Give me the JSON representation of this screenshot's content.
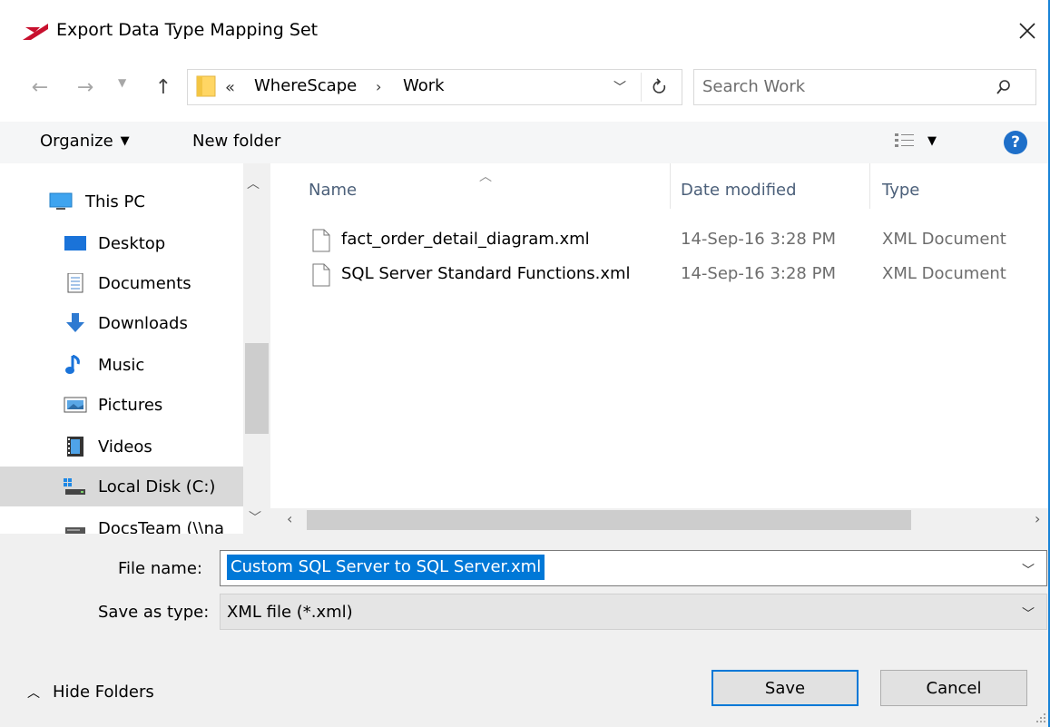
{
  "window": {
    "title": "Export Data Type Mapping Set",
    "close_icon": "close-icon",
    "accent_color": "#0078d7"
  },
  "address": {
    "chevron": "«",
    "breadcrumbs": [
      "WhereScape",
      "Work"
    ],
    "separator": "›"
  },
  "search": {
    "placeholder": "Search Work"
  },
  "toolbar": {
    "organize_label": "Organize",
    "new_folder_label": "New folder",
    "help_label": "?"
  },
  "nav": {
    "items": [
      {
        "label": "This PC",
        "icon": "this-pc-icon"
      },
      {
        "label": "Desktop",
        "icon": "desktop-icon"
      },
      {
        "label": "Documents",
        "icon": "documents-icon"
      },
      {
        "label": "Downloads",
        "icon": "downloads-icon"
      },
      {
        "label": "Music",
        "icon": "music-icon"
      },
      {
        "label": "Pictures",
        "icon": "pictures-icon"
      },
      {
        "label": "Videos",
        "icon": "videos-icon"
      },
      {
        "label": "Local Disk (C:)",
        "icon": "local-disk-icon"
      },
      {
        "label": "DocsTeam (\\\\na",
        "icon": "network-drive-icon"
      }
    ],
    "selected_index": 7
  },
  "files": {
    "columns": [
      "Name",
      "Date modified",
      "Type"
    ],
    "rows": [
      {
        "name": "fact_order_detail_diagram.xml",
        "date": "14-Sep-16 3:28 PM",
        "type": "XML Document"
      },
      {
        "name": "SQL Server Standard Functions.xml",
        "date": "14-Sep-16 3:28 PM",
        "type": "XML Document"
      }
    ]
  },
  "form": {
    "file_name_label": "File name:",
    "file_name_value": "Custom SQL Server to SQL Server.xml",
    "save_type_label": "Save as type:",
    "save_type_value": "XML file (*.xml)"
  },
  "footer": {
    "hide_folders_label": "Hide Folders",
    "save_label": "Save",
    "cancel_label": "Cancel"
  }
}
